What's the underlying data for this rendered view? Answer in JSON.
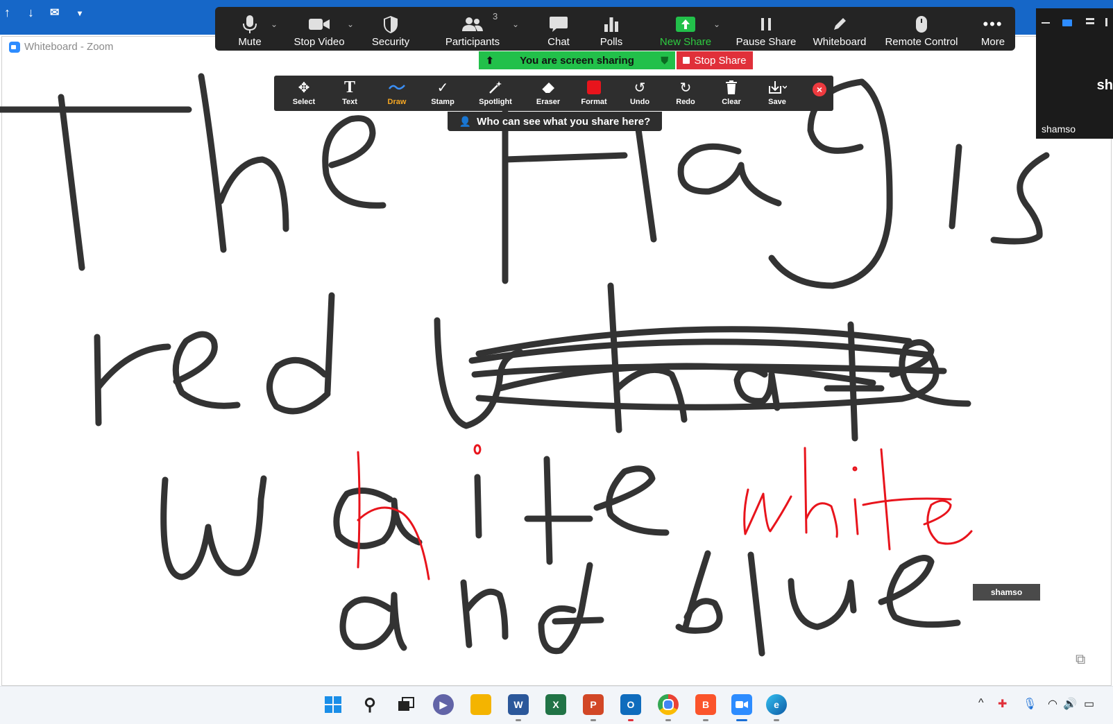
{
  "window": {
    "title": "Whiteboard - Zoom"
  },
  "meeting_toolbar": {
    "mute": "Mute",
    "stop_video": "Stop Video",
    "security": "Security",
    "participants": "Participants",
    "participants_count": "3",
    "chat": "Chat",
    "polls": "Polls",
    "new_share": "New Share",
    "pause_share": "Pause Share",
    "whiteboard": "Whiteboard",
    "remote_control": "Remote Control",
    "more": "More"
  },
  "sharing": {
    "banner": "You are screen sharing",
    "stop": "Stop Share"
  },
  "annotation_toolbar": {
    "select": "Select",
    "text": "Text",
    "draw": "Draw",
    "stamp": "Stamp",
    "spotlight": "Spotlight",
    "eraser": "Eraser",
    "format": "Format",
    "undo": "Undo",
    "redo": "Redo",
    "clear": "Clear",
    "save": "Save",
    "who_can_see": "Who can see what you share here?"
  },
  "video": {
    "name": "shamso",
    "initials": "sh"
  },
  "annotation_tag": "shamso",
  "colors": {
    "ink": "#333333",
    "red_ink": "#e8141c",
    "accent_green": "#22c04a",
    "stop_red": "#e0303a",
    "zoom_blue": "#2d8cff"
  },
  "taskbar_apps": [
    "start-icon",
    "search-icon",
    "task-view-icon",
    "chat-icon",
    "file-explorer-icon",
    "word-icon",
    "excel-icon",
    "powerpoint-icon",
    "outlook-icon",
    "chrome-icon",
    "brave-icon",
    "zoom-icon",
    "edge-icon"
  ]
}
